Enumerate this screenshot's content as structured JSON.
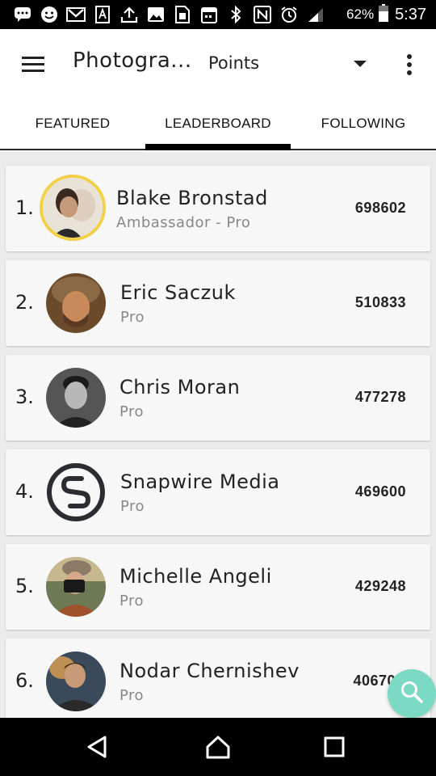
{
  "status_bar": {
    "battery_percent": "62%",
    "time": "5:37"
  },
  "app_bar": {
    "title": "Photogra...",
    "sort_value": "Points"
  },
  "tabs": [
    {
      "label": "FEATURED",
      "active": false
    },
    {
      "label": "LEADERBOARD",
      "active": true
    },
    {
      "label": "FOLLOWING",
      "active": false
    }
  ],
  "leaderboard": [
    {
      "rank": "1.",
      "name": "Blake Bronstad",
      "level": "Ambassador - Pro",
      "points": "698602",
      "highlight": true
    },
    {
      "rank": "2.",
      "name": "Eric Saczuk",
      "level": "Pro",
      "points": "510833"
    },
    {
      "rank": "3.",
      "name": "Chris Moran",
      "level": "Pro",
      "points": "477278"
    },
    {
      "rank": "4.",
      "name": "Snapwire Media",
      "level": "Pro",
      "points": "469600"
    },
    {
      "rank": "5.",
      "name": "Michelle Angeli",
      "level": "Pro",
      "points": "429248"
    },
    {
      "rank": "6.",
      "name": "Nodar Chernishev",
      "level": "Pro",
      "points": "40670"
    }
  ],
  "colors": {
    "accent_gold": "#f2d04a",
    "fab": "#7bd9c4"
  },
  "icons": {
    "menu": "hamburger-menu-icon",
    "sort_dropdown": "caret-down-icon",
    "more": "more-vert-icon",
    "fab": "search-icon"
  }
}
